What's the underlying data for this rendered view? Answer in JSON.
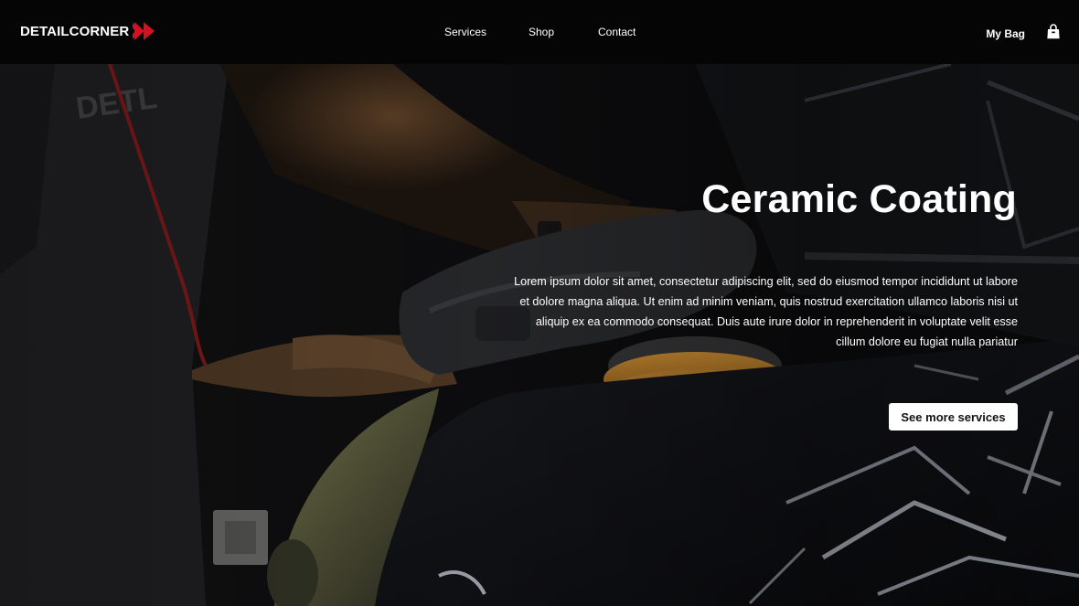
{
  "brand": {
    "name": "DETAILCORNER",
    "accent_color": "#d4111e",
    "logo_icon": "double-chevron-right-icon"
  },
  "nav": {
    "links": [
      {
        "label": "Services"
      },
      {
        "label": "Shop"
      },
      {
        "label": "Contact"
      }
    ],
    "bag_label": "My Bag",
    "bag_icon": "shopping-bag-icon"
  },
  "hero": {
    "title": "Ceramic Coating",
    "description": "Lorem ipsum dolor sit amet, consectetur adipiscing elit, sed do eiusmod tempor incididunt ut labore et dolore magna aliqua. Ut enim ad minim veniam, quis nostrud exercitation ullamco laboris nisi ut aliquip ex ea commodo consequat. Duis aute irure dolor in reprehenderit in voluptate velit esse cillum dolore eu fugiat nulla pariatur",
    "button_label": "See more services",
    "background_image": "technician-polishing-car-with-orbital-polisher"
  }
}
